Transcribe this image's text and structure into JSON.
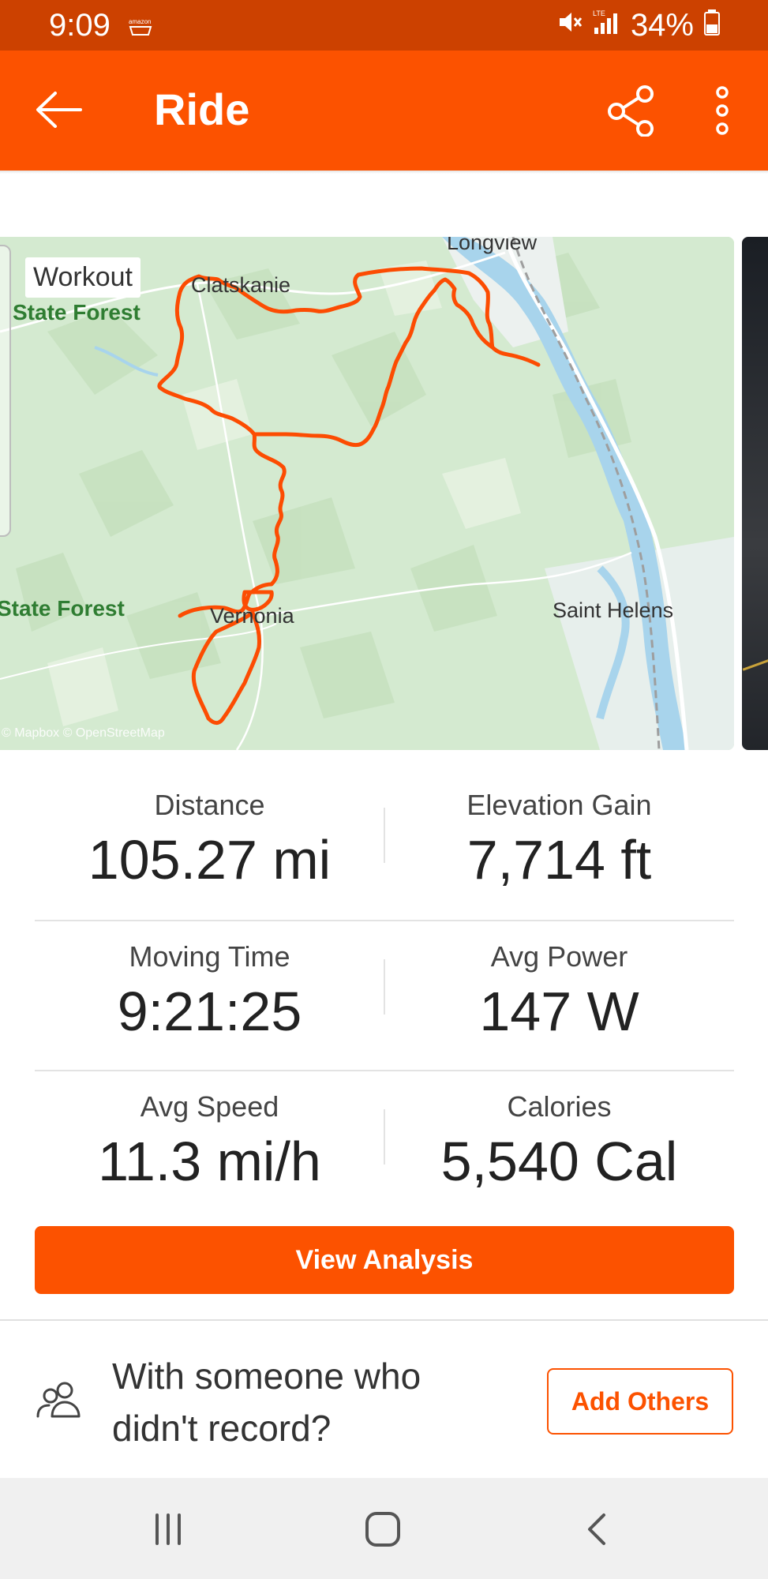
{
  "status_bar": {
    "time": "9:09",
    "battery": "34%",
    "network": "LTE"
  },
  "header": {
    "title": "Ride",
    "back_icon": "arrow-left-icon",
    "share_icon": "share-icon",
    "more_icon": "more-vertical-icon"
  },
  "map": {
    "chip_label": "Workout",
    "places": {
      "longview": "Longview",
      "clatskanie": "Clatskanie",
      "vernonia": "Vernonia",
      "saint_helens": "Saint Helens"
    },
    "forest_top": "State Forest",
    "forest_bottom": "State Forest",
    "attribution": "© Mapbox © OpenStreetMap",
    "route_color": "#fc4c02"
  },
  "stats": {
    "distance": {
      "label": "Distance",
      "value": "105.27 mi"
    },
    "elevation": {
      "label": "Elevation Gain",
      "value": "7,714 ft"
    },
    "moving_time": {
      "label": "Moving Time",
      "value": "9:21:25"
    },
    "avg_power": {
      "label": "Avg Power",
      "value": "147 W"
    },
    "avg_speed": {
      "label": "Avg Speed",
      "value": "11.3 mi/h"
    },
    "calories": {
      "label": "Calories",
      "value": "5,540 Cal"
    }
  },
  "actions": {
    "view_analysis": "View Analysis",
    "others_prompt": "With someone who didn't record?",
    "add_others": "Add Others"
  },
  "colors": {
    "brand": "#fc5200",
    "status_bar": "#cc4100"
  }
}
